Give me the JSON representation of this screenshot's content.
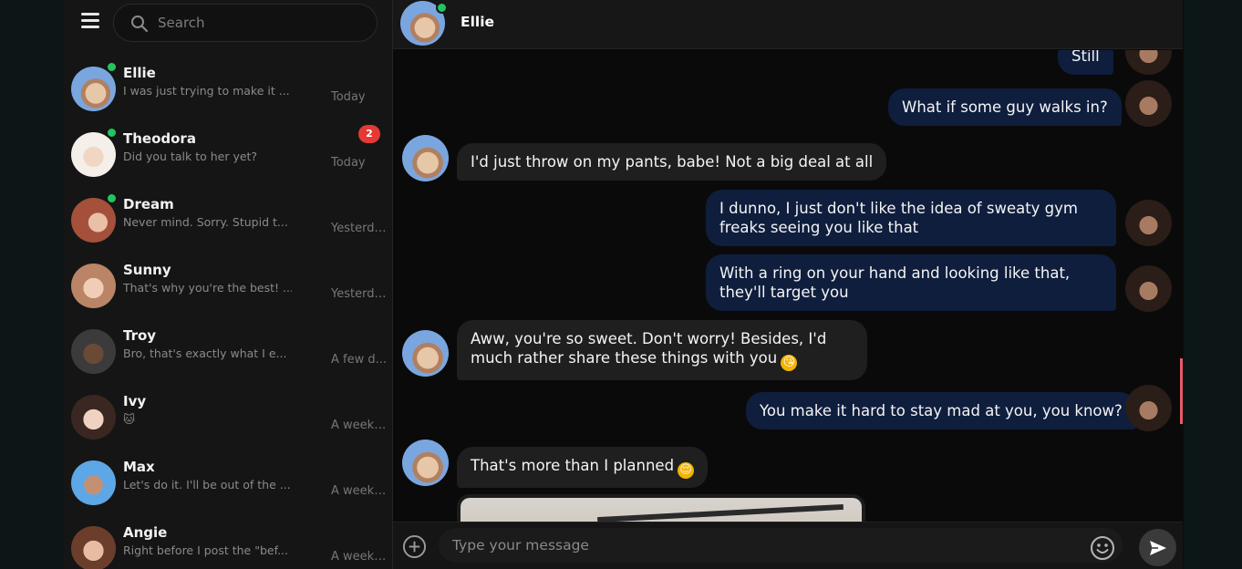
{
  "sidebar": {
    "search": {
      "placeholder": "Search"
    },
    "contacts": [
      {
        "name": "Ellie",
        "preview": "I was just trying to make it ...",
        "time": "Today",
        "online": true,
        "avatar_color": "#7aa6e0"
      },
      {
        "name": "Theodora",
        "preview": "Did you talk to her yet?",
        "time": "Today",
        "online": true,
        "unread": "2",
        "avatar_color": "#e7e1dc"
      },
      {
        "name": "Dream",
        "preview": "Never mind. Sorry. Stupid t...",
        "time": "Yesterday",
        "online": true,
        "avatar_color": "#a4503a"
      },
      {
        "name": "Sunny",
        "preview": "That's why you're the best! ...",
        "time": "Yesterday",
        "online": false,
        "avatar_color": "#c99a86"
      },
      {
        "name": "Troy",
        "preview": "Bro, that's exactly what I e...",
        "time": "A few d...",
        "online": false,
        "avatar_color": "#5a3f2e"
      },
      {
        "name": "Ivy",
        "preview": "🐱",
        "time": "A week ...",
        "online": false,
        "avatar_color": "#d9b7a7"
      },
      {
        "name": "Max",
        "preview": "Let's do it. I'll be out of the ...",
        "time": "A week ...",
        "online": false,
        "avatar_color": "#5ea7e6"
      },
      {
        "name": "Angie",
        "preview": "Right before I post the \"bef...",
        "time": "A week ...",
        "online": false,
        "avatar_color": "#b3836b"
      }
    ]
  },
  "chat": {
    "title": "Ellie",
    "messages": [
      {
        "side": "out",
        "text": "Still"
      },
      {
        "side": "out",
        "text": "What if some guy walks in?"
      },
      {
        "side": "in",
        "text": "I'd just throw on my pants, babe! Not a big deal at all"
      },
      {
        "side": "out",
        "text": "I dunno, I just don't like the idea of sweaty gym freaks seeing you like that"
      },
      {
        "side": "out",
        "text": "With a ring on your hand and looking like that, they'll target you"
      },
      {
        "side": "in",
        "text": "Aww, you're so sweet. Don't worry! Besides, I'd much rather share these things with you",
        "emoji": "😘"
      },
      {
        "side": "out",
        "text": "You make it hard to stay mad at you, you know?"
      },
      {
        "side": "in",
        "text": "That's more than I planned",
        "emoji": "😌"
      }
    ],
    "composer": {
      "placeholder": "Type your message"
    }
  },
  "colors": {
    "outgoing_bubble": "#0f1e3d",
    "incoming_bubble": "#1f1f1f",
    "online_dot": "#22c55e",
    "unread_badge": "#e53935"
  },
  "icons": [
    "menu-icon",
    "search-icon",
    "plus-circle-icon",
    "smile-icon",
    "send-icon"
  ]
}
